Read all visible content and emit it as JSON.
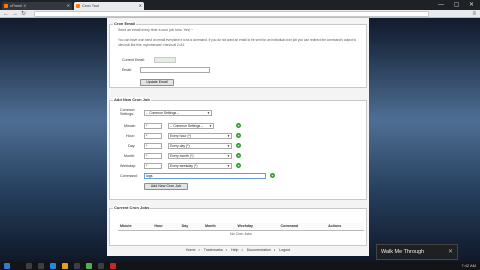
{
  "browser": {
    "tabs": [
      {
        "title": "cPanel X",
        "active": false
      },
      {
        "title": "Cron Tool",
        "active": true
      }
    ],
    "window_controls": "— ▢ ✕"
  },
  "cron_email": {
    "legend": "Cron Email",
    "intro": "Send an email every time a cron job runs. Yes! ~",
    "description": "You can have cron send an email everytime it runs a command. If you do not want an email to be sent for an individual cron job you can redirect the command's output to /dev/null like this: mycommand >/dev/null 2>&1",
    "current_email_label": "Current Email:",
    "current_email_value": "",
    "email_label": "Email:",
    "email_value": "",
    "update_button": "Update Email"
  },
  "add_cron": {
    "legend": "Add New Cron Job",
    "common_settings_label": "Common Settings:",
    "common_settings_value": "-- Common Settings --",
    "rows": [
      {
        "label": "Minute:",
        "value": "*",
        "select": "-- Common Settings --"
      },
      {
        "label": "Hour:",
        "value": "*",
        "select": "Every hour (*)"
      },
      {
        "label": "Day:",
        "value": "*",
        "select": "Every day (*)"
      },
      {
        "label": "Month:",
        "value": "*",
        "select": "Every month (*)"
      },
      {
        "label": "Weekday:",
        "value": "*",
        "select": "Every weekday (*)"
      }
    ],
    "command_label": "Command:",
    "command_value": "logs",
    "add_button": "Add New Cron Job"
  },
  "current_jobs": {
    "legend": "Current Cron Jobs",
    "columns": [
      "Minute",
      "Hour",
      "Day",
      "Month",
      "Weekday",
      "Command",
      "Actions"
    ],
    "empty_message": "No Cron Jobs"
  },
  "footer": {
    "links": [
      "Home",
      "Trademarks",
      "Help",
      "Documentation",
      "Logout"
    ]
  },
  "taskbar": {
    "clock": "7:42 AM"
  },
  "tooltip": {
    "text": "Walk Me Through",
    "close": "✕"
  },
  "colors": {
    "add_icon": "#2f9e2f",
    "page_bg": "#f4f4f4"
  }
}
